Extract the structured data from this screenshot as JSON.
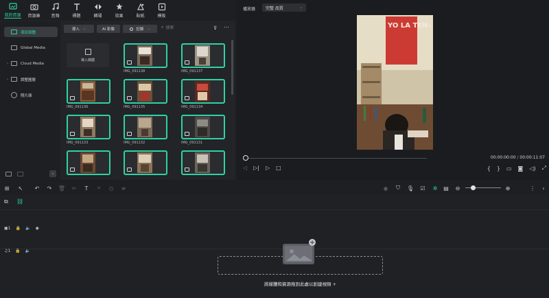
{
  "top_tabs": [
    {
      "label": "我的資源",
      "icon": "my-media-icon",
      "active": true
    },
    {
      "label": "資源庫",
      "icon": "stock-icon",
      "active": false
    },
    {
      "label": "音頻",
      "icon": "audio-icon",
      "active": false
    },
    {
      "label": "標題",
      "icon": "title-icon",
      "active": false
    },
    {
      "label": "轉場",
      "icon": "transition-icon",
      "active": false
    },
    {
      "label": "效果",
      "icon": "effects-icon",
      "active": false
    },
    {
      "label": "貼紙",
      "icon": "sticker-icon",
      "active": false
    },
    {
      "label": "模板",
      "icon": "template-icon",
      "active": false
    }
  ],
  "sidebar": {
    "items": [
      {
        "label": "項目媒體",
        "active": true,
        "expandable": false
      },
      {
        "label": "Global Media",
        "active": false,
        "expandable": false
      },
      {
        "label": "Cloud Media",
        "active": false,
        "expandable": true
      },
      {
        "label": "調整圖層",
        "active": false,
        "expandable": true
      },
      {
        "label": "照片庫",
        "active": false,
        "expandable": false
      }
    ]
  },
  "media_toolbar": {
    "import_label": "導入",
    "ai_label": "AI 影像",
    "record_label": "記錄",
    "search_placeholder": "搜索"
  },
  "media_grid": {
    "import_tile_label": "導入媒體",
    "items": [
      {
        "name": "IMG_091138"
      },
      {
        "name": "IMG_091137"
      },
      {
        "name": "IMG_091136"
      },
      {
        "name": "IMG_091135"
      },
      {
        "name": "IMG_091134"
      },
      {
        "name": "IMG_091133"
      },
      {
        "name": "IMG_091132"
      },
      {
        "name": "IMG_091131"
      },
      {
        "name": ""
      },
      {
        "name": ""
      },
      {
        "name": ""
      }
    ]
  },
  "player": {
    "title": "播放器",
    "quality": "完整 品質",
    "current_time": "00:00:00:00",
    "total_time": "00:00:11:07",
    "poster_text": "YO LA TEN- GO"
  },
  "timeline": {
    "video_track_label": "1",
    "audio_track_label": "1",
    "drop_hint": "將媒體和資源拖到此處以創建視頻 +"
  },
  "colors": {
    "accent": "#2ed3a6",
    "panel": "#232428",
    "background": "#1d1e21"
  }
}
